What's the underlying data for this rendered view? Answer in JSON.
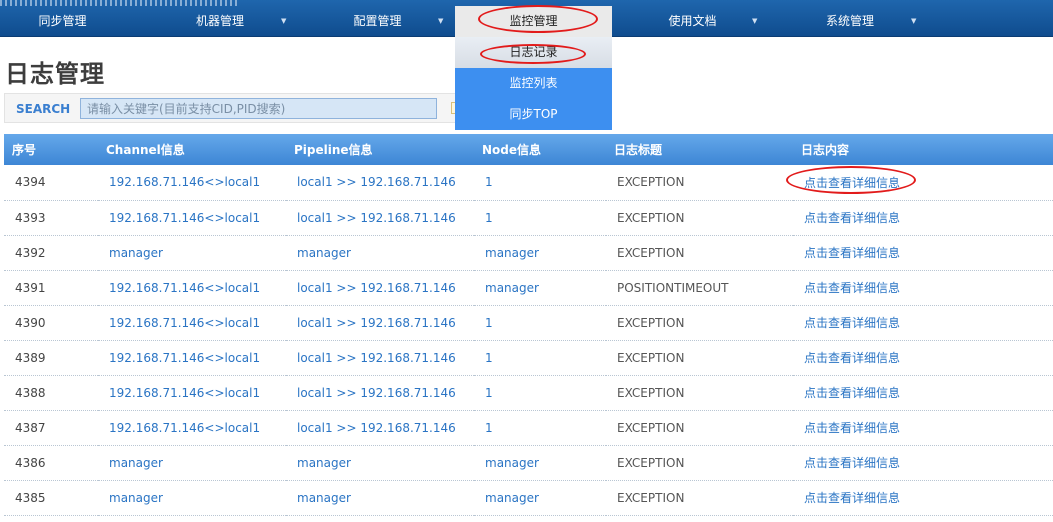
{
  "nav": {
    "items": [
      {
        "label": "同步管理",
        "has_caret": false
      },
      {
        "label": "机器管理",
        "has_caret": true
      },
      {
        "label": "配置管理",
        "has_caret": true
      },
      {
        "label": "监控管理",
        "has_caret": false
      },
      {
        "label": "使用文档",
        "has_caret": true
      },
      {
        "label": "系统管理",
        "has_caret": true
      }
    ],
    "caret": "▼"
  },
  "dropdown": {
    "items": [
      {
        "label": "日志记录"
      },
      {
        "label": "监控列表"
      },
      {
        "label": "同步TOP"
      }
    ]
  },
  "page": {
    "title": "日志管理"
  },
  "search": {
    "label": "SEARCH",
    "placeholder": "请输入关键字(目前支持CID,PID搜索)",
    "value": ""
  },
  "table": {
    "headers": [
      "序号",
      "Channel信息",
      "Pipeline信息",
      "Node信息",
      "日志标题",
      "日志内容"
    ],
    "rows": [
      [
        "4394",
        "192.168.71.146<>local1",
        "local1 >> 192.168.71.146",
        "1",
        "EXCEPTION",
        "点击查看详细信息"
      ],
      [
        "4393",
        "192.168.71.146<>local1",
        "local1 >> 192.168.71.146",
        "1",
        "EXCEPTION",
        "点击查看详细信息"
      ],
      [
        "4392",
        "manager",
        "manager",
        "manager",
        "EXCEPTION",
        "点击查看详细信息"
      ],
      [
        "4391",
        "192.168.71.146<>local1",
        "local1 >> 192.168.71.146",
        "manager",
        "POSITIONTIMEOUT",
        "点击查看详细信息"
      ],
      [
        "4390",
        "192.168.71.146<>local1",
        "local1 >> 192.168.71.146",
        "1",
        "EXCEPTION",
        "点击查看详细信息"
      ],
      [
        "4389",
        "192.168.71.146<>local1",
        "local1 >> 192.168.71.146",
        "1",
        "EXCEPTION",
        "点击查看详细信息"
      ],
      [
        "4388",
        "192.168.71.146<>local1",
        "local1 >> 192.168.71.146",
        "1",
        "EXCEPTION",
        "点击查看详细信息"
      ],
      [
        "4387",
        "192.168.71.146<>local1",
        "local1 >> 192.168.71.146",
        "1",
        "EXCEPTION",
        "点击查看详细信息"
      ],
      [
        "4386",
        "manager",
        "manager",
        "manager",
        "EXCEPTION",
        "点击查看详细信息"
      ],
      [
        "4385",
        "manager",
        "manager",
        "manager",
        "EXCEPTION",
        "点击查看详细信息"
      ]
    ]
  },
  "colors": {
    "nav_bg": "#1a5ea6",
    "dropdown_bg": "#3d8ff0",
    "link": "#2a74c4",
    "annotation": "#e21b1b"
  }
}
